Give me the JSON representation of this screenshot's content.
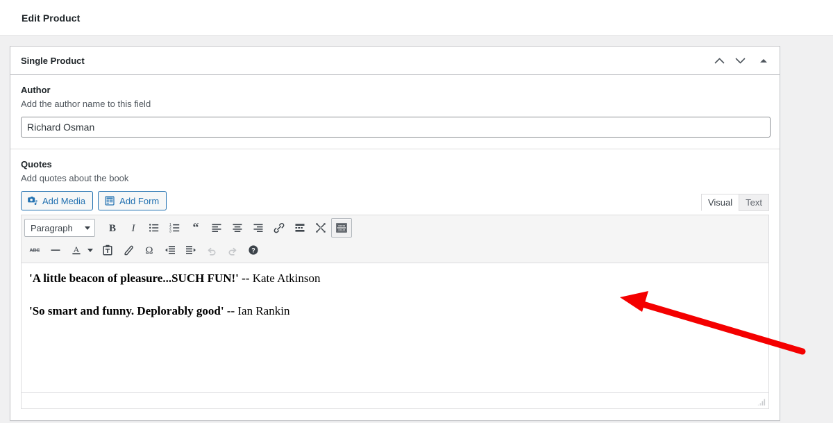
{
  "topbar": {
    "title": "Edit Product"
  },
  "postbox": {
    "title": "Single Product",
    "actions": {
      "move_up": "Move up",
      "move_down": "Move down",
      "toggle": "Toggle panel"
    }
  },
  "fields": {
    "author": {
      "label": "Author",
      "description": "Add the author name to this field",
      "value": "Richard Osman",
      "placeholder": ""
    },
    "quotes": {
      "label": "Quotes",
      "description": "Add quotes about the book"
    }
  },
  "media_buttons": {
    "add_media": "Add Media",
    "add_form": "Add Form"
  },
  "editor_tabs": {
    "visual": "Visual",
    "text": "Text",
    "active": "Visual"
  },
  "toolbar": {
    "format_select": "Paragraph",
    "row1": [
      {
        "name": "bold-icon",
        "title": "Bold"
      },
      {
        "name": "italic-icon",
        "title": "Italic"
      },
      {
        "name": "bulleted-list-icon",
        "title": "Bulleted list"
      },
      {
        "name": "numbered-list-icon",
        "title": "Numbered list"
      },
      {
        "name": "blockquote-icon",
        "title": "Blockquote"
      },
      {
        "name": "align-left-icon",
        "title": "Align left"
      },
      {
        "name": "align-center-icon",
        "title": "Align center"
      },
      {
        "name": "align-right-icon",
        "title": "Align right"
      },
      {
        "name": "link-icon",
        "title": "Insert/edit link"
      },
      {
        "name": "read-more-icon",
        "title": "Insert Read More tag"
      },
      {
        "name": "fullscreen-icon",
        "title": "Distraction-free writing mode"
      },
      {
        "name": "toolbar-toggle-icon",
        "title": "Toolbar Toggle"
      }
    ],
    "row2": [
      {
        "name": "strikethrough-icon",
        "title": "Strikethrough"
      },
      {
        "name": "horizontal-rule-icon",
        "title": "Horizontal line"
      },
      {
        "name": "text-color-icon",
        "title": "Text color"
      },
      {
        "name": "paste-as-text-icon",
        "title": "Paste as text"
      },
      {
        "name": "clear-formatting-icon",
        "title": "Clear formatting"
      },
      {
        "name": "special-character-icon",
        "title": "Special character"
      },
      {
        "name": "outdent-icon",
        "title": "Decrease indent"
      },
      {
        "name": "indent-icon",
        "title": "Increase indent"
      },
      {
        "name": "undo-icon",
        "title": "Undo"
      },
      {
        "name": "redo-icon",
        "title": "Redo"
      },
      {
        "name": "help-icon",
        "title": "Keyboard Shortcuts"
      }
    ]
  },
  "editor_content": {
    "paragraphs": [
      {
        "quote": "'A little beacon of pleasure...SUCH FUN!'",
        "attribution": " -- Kate Atkinson"
      },
      {
        "quote": "'So smart and funny. Deplorably good'",
        "attribution": " -- Ian Rankin"
      }
    ]
  },
  "statusbar": {
    "resize": "Resize editor"
  },
  "annotation": {
    "arrow_color": "#f40000"
  },
  "colors": {
    "accent": "#2271b1",
    "page_background": "#f0f0f1",
    "panel_background": "#ffffff",
    "border": "#c3c4c7",
    "text": "#1d2327",
    "muted_text": "#50575e"
  }
}
